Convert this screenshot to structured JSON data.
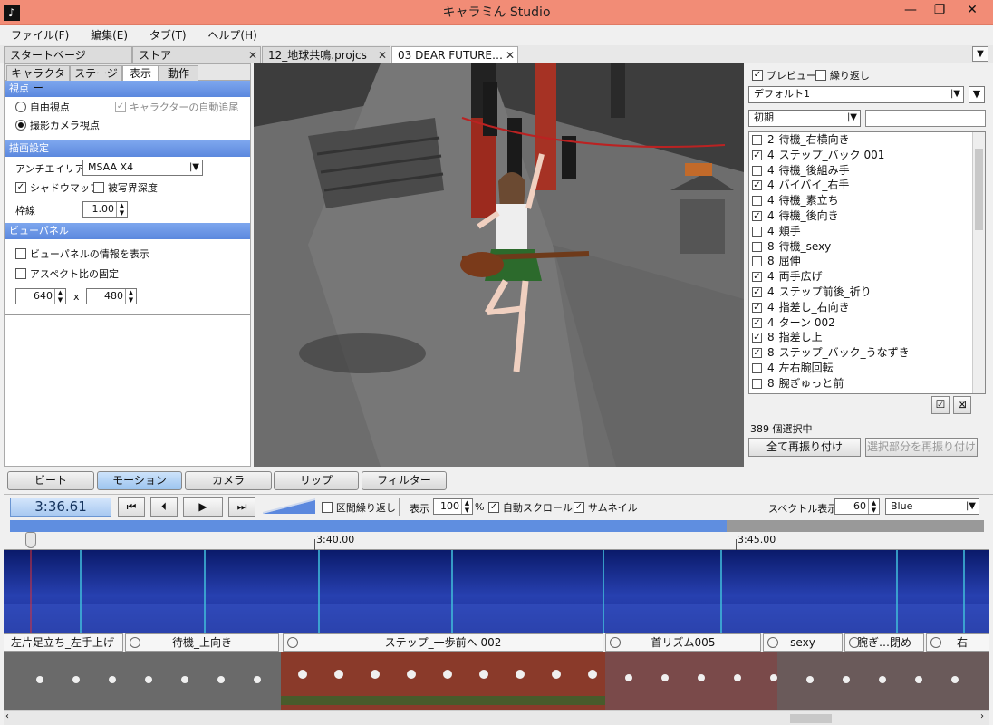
{
  "window": {
    "title": "キャラミん Studio",
    "app_icon": "music-note-icon",
    "minimize": "—",
    "maximize": "❐",
    "close": "✕"
  },
  "menu": [
    "ファイル(F)",
    "編集(E)",
    "タブ(T)",
    "ヘルプ(H)"
  ],
  "doc_tabs": [
    {
      "label": "スタートページ"
    },
    {
      "label": "ストア"
    },
    {
      "label": "12_地球共鳴.projcs"
    },
    {
      "label": "03 DEAR FUTURE…"
    }
  ],
  "left": {
    "subtabs": [
      "キャラクター",
      "ステージ",
      "表示",
      "動作"
    ],
    "viewpoint": {
      "header": "視点",
      "free": "自由視点",
      "camera": "撮影カメラ視点",
      "auto_follow": "キャラクターの自動追尾"
    },
    "render": {
      "header": "描画設定",
      "aa_label": "アンチエイリアス",
      "aa_value": "MSAA X4",
      "shadow": "シャドウマップ",
      "dof": "被写界深度",
      "outline_label": "枠線",
      "outline_value": "1.00"
    },
    "viewpanel": {
      "header": "ビューパネル",
      "show_info": "ビューパネルの情報を表示",
      "fix_aspect": "アスペクト比の固定",
      "width": "640",
      "x": "x",
      "height": "480"
    }
  },
  "right": {
    "preview": "プレビュー",
    "loop": "繰り返し",
    "preset": "デフォルト1",
    "category": "初期",
    "search": "",
    "motions": [
      {
        "n": "2",
        "name": "待機_右横向き",
        "checked": false
      },
      {
        "n": "4",
        "name": "ステップ_バック 001",
        "checked": true
      },
      {
        "n": "4",
        "name": "待機_後組み手",
        "checked": false
      },
      {
        "n": "4",
        "name": "バイバイ_右手",
        "checked": true
      },
      {
        "n": "4",
        "name": "待機_素立ち",
        "checked": false
      },
      {
        "n": "4",
        "name": "待機_後向き",
        "checked": true
      },
      {
        "n": "4",
        "name": "頬手",
        "checked": false
      },
      {
        "n": "8",
        "name": "待機_sexy",
        "checked": false
      },
      {
        "n": "8",
        "name": "屈伸",
        "checked": false
      },
      {
        "n": "4",
        "name": "両手広げ",
        "checked": true
      },
      {
        "n": "4",
        "name": "ステップ前後_祈り",
        "checked": true
      },
      {
        "n": "4",
        "name": "指差し_右向き",
        "checked": true
      },
      {
        "n": "4",
        "name": "ターン 002",
        "checked": true
      },
      {
        "n": "8",
        "name": "指差し上",
        "checked": true
      },
      {
        "n": "8",
        "name": "ステップ_バック_うなずき",
        "checked": true
      },
      {
        "n": "4",
        "name": "左右腕回転",
        "checked": false
      },
      {
        "n": "8",
        "name": "腕ぎゅっと前",
        "checked": false
      }
    ],
    "selected_count": "389 個選択中",
    "reassign_all": "全て再振り付け",
    "reassign_selected": "選択部分を再振り付け"
  },
  "bottom": {
    "tabs": [
      "ビート",
      "モーション",
      "カメラ",
      "リップ",
      "フィルター"
    ],
    "time": "3:36.61",
    "range_loop": "区間繰り返し",
    "display_label": "表示",
    "display_value": "100",
    "percent": "%",
    "auto_scroll": "自動スクロール",
    "thumbnail": "サムネイル",
    "spectrum_label": "スペクトル表示",
    "spectrum_value": "60",
    "color_value": "Blue",
    "ticks": [
      "3:40.00",
      "3:45.00"
    ],
    "playhead_fraction": 0.736,
    "motion_labels": [
      "左片足立ち_左手上げ",
      "待機_上向き",
      "ステップ_一歩前へ 002",
      "首リズム005",
      "sexy",
      "腕ぎ…閉め",
      "右"
    ]
  },
  "colors": {
    "titlebar": "#f28c76",
    "accent": "#5b88de",
    "spectrum": "#1c2f92"
  }
}
